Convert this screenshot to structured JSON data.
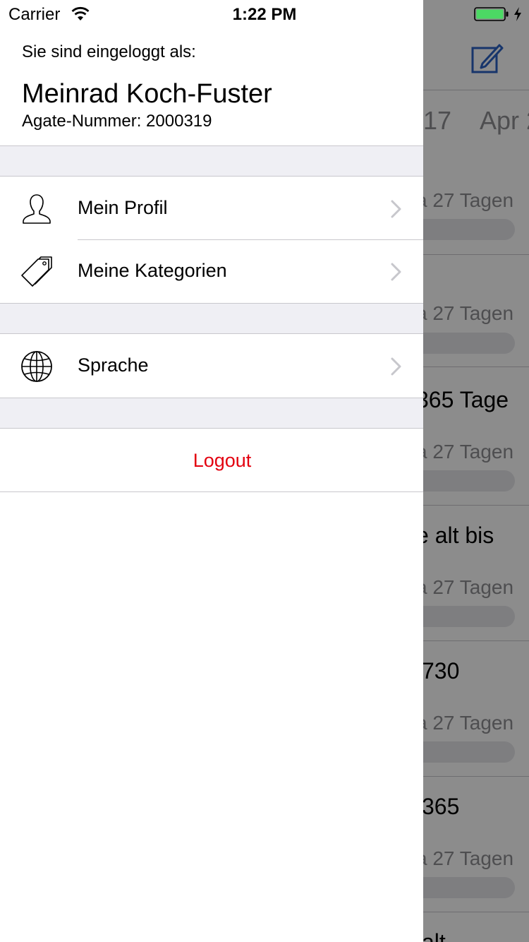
{
  "status_bar": {
    "carrier": "Carrier",
    "time": "1:22 PM"
  },
  "background": {
    "dates": [
      "17",
      "Apr 2"
    ],
    "rows": [
      {
        "title": "",
        "subtitle": "a 27 Tagen"
      },
      {
        "title": "",
        "subtitle": "a 27 Tagen"
      },
      {
        "title": "365 Tage",
        "subtitle": "a 27 Tagen"
      },
      {
        "title": "e alt bis",
        "subtitle": "a 27 Tagen"
      },
      {
        "title": "730",
        "subtitle": "a 27 Tagen"
      },
      {
        "title": "365",
        "subtitle": "a 27 Tagen"
      },
      {
        "title": "alt",
        "subtitle": ""
      }
    ]
  },
  "drawer": {
    "logged_in_label": "Sie sind eingeloggt als:",
    "user_name": "Meinrad Koch-Fuster",
    "agate_number": "Agate-Nummer: 2000319",
    "menu": {
      "profile": "Mein Profil",
      "categories": "Meine Kategorien",
      "language": "Sprache"
    },
    "logout": "Logout"
  },
  "colors": {
    "accent_blue": "#2b62c4",
    "logout_red": "#e3000f",
    "battery_green": "#4cd964",
    "section_gray": "#efeff4"
  }
}
